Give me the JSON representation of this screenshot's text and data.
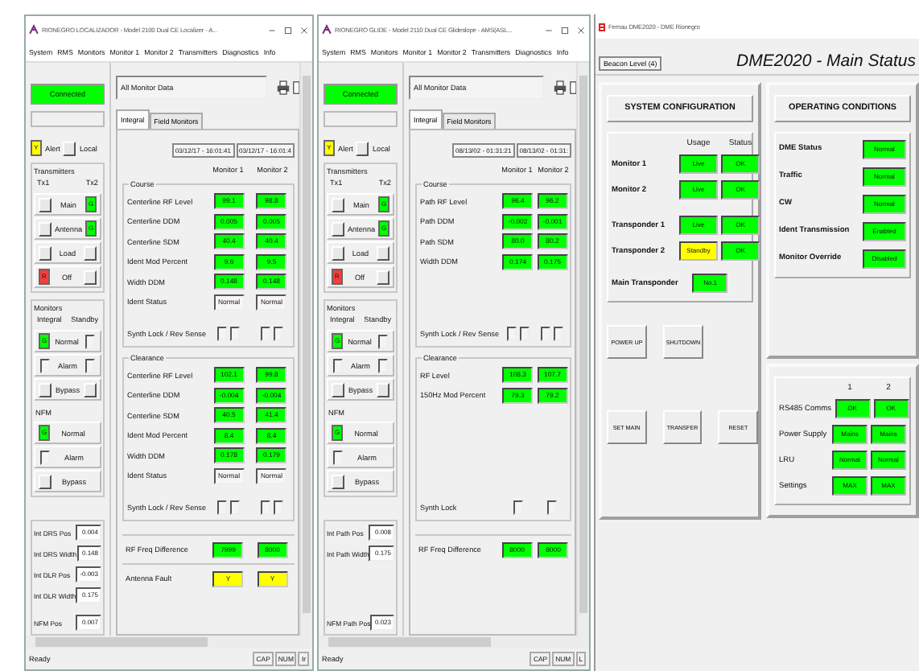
{
  "windows": [
    {
      "title": "RIONEGRO LOCALIZADOR - Model 2100 Dual CE Localizer - A...",
      "menu": [
        "System",
        "RMS",
        "Monitors",
        "Monitor 1",
        "Monitor 2",
        "Transmitters",
        "Diagnostics",
        "Info"
      ],
      "connection": "Connected",
      "alert": {
        "text": "Y",
        "color": "#ffff00",
        "label": "Alert",
        "local": "Local"
      },
      "transmitters": {
        "title": "Transmitters",
        "headers": [
          "Tx1",
          "Tx2"
        ],
        "rows": [
          {
            "label": "Main",
            "left": {
              "kind": "button"
            },
            "right": {
              "kind": "lamp",
              "text": "G",
              "color": "#00ff00"
            }
          },
          {
            "label": "Antenna",
            "left": {
              "kind": "button"
            },
            "right": {
              "kind": "lamp",
              "text": "G",
              "color": "#00ff00"
            }
          },
          {
            "label": "Load",
            "left": {
              "kind": "button"
            },
            "right": {
              "kind": "button"
            }
          },
          {
            "label": "Off",
            "left": {
              "kind": "lamp",
              "text": "R",
              "color": "#ff3b3b"
            },
            "right": {
              "kind": "button"
            }
          }
        ]
      },
      "monitors": {
        "title": "Monitors",
        "headers": [
          "Integral",
          "Standby"
        ],
        "rows": [
          {
            "label": "Normal",
            "left": {
              "kind": "lamp",
              "text": "G",
              "color": "#00ff00"
            },
            "right": {
              "kind": "box"
            }
          },
          {
            "label": "Alarm",
            "left": {
              "kind": "box"
            },
            "right": {
              "kind": "box"
            }
          },
          {
            "label": "Bypass",
            "left": {
              "kind": "button"
            },
            "right": {
              "kind": "button"
            }
          }
        ]
      },
      "nfm": {
        "title": "NFM",
        "rows": [
          {
            "label": "Normal",
            "left": {
              "kind": "lamp",
              "text": "G",
              "color": "#00ff00"
            }
          },
          {
            "label": "Alarm",
            "left": {
              "kind": "box"
            }
          },
          {
            "label": "Bypass",
            "left": {
              "kind": "button"
            }
          }
        ]
      },
      "readouts": [
        {
          "label": "Int DRS Pos",
          "value": "0.004"
        },
        {
          "label": "Int DRS Width",
          "value": "0.148"
        },
        {
          "label": "Int DLR Pos",
          "value": "-0.003"
        },
        {
          "label": "Int DLR Width",
          "value": "0.175"
        },
        {
          "label": "NFM Pos",
          "value": "0.007"
        }
      ],
      "data_title": "All Monitor Data",
      "tabs": [
        {
          "label": "Integral",
          "selected": true
        },
        {
          "label": "Field Monitors",
          "selected": false
        }
      ],
      "timestamps": [
        "03/12/17 - 16:01:41",
        "03/12/17 - 16:01:4"
      ],
      "columns": [
        "Monitor 1",
        "Monitor 2"
      ],
      "sections": [
        {
          "title": "Course",
          "rows": [
            {
              "label": "Centerline RF Level",
              "kind": "value",
              "values": [
                "99.1",
                "98.8"
              ],
              "color": "#00ff00"
            },
            {
              "label": "Centerline DDM",
              "kind": "value",
              "values": [
                "0.005",
                "0.005"
              ],
              "color": "#00ff00"
            },
            {
              "label": "Centerline SDM",
              "kind": "value",
              "values": [
                "40.4",
                "40.4"
              ],
              "color": "#00ff00"
            },
            {
              "label": "Ident Mod Percent",
              "kind": "value",
              "values": [
                "9.6",
                "9.5"
              ],
              "color": "#00ff00"
            },
            {
              "label": "Width DDM",
              "kind": "value",
              "values": [
                "0.148",
                "0.148"
              ],
              "color": "#00ff00"
            },
            {
              "label": "Ident Status",
              "kind": "status",
              "values": [
                "Normal",
                "Normal"
              ]
            },
            {
              "label": "Synth Lock / Rev Sense",
              "kind": "checks"
            }
          ]
        },
        {
          "title": "Clearance",
          "rows": [
            {
              "label": "Centerline RF Level",
              "kind": "value",
              "values": [
                "102.1",
                "99.8"
              ],
              "color": "#00ff00"
            },
            {
              "label": "Centerline DDM",
              "kind": "value",
              "values": [
                "-0.004",
                "-0.004"
              ],
              "color": "#00ff00"
            },
            {
              "label": "Centerline SDM",
              "kind": "value",
              "values": [
                "40.5",
                "41.4"
              ],
              "color": "#00ff00"
            },
            {
              "label": "Ident Mod Percent",
              "kind": "value",
              "values": [
                "8.4",
                "8.4"
              ],
              "color": "#00ff00"
            },
            {
              "label": "Width DDM",
              "kind": "value",
              "values": [
                "0.178",
                "0.179"
              ],
              "color": "#00ff00"
            },
            {
              "label": "Ident Status",
              "kind": "status",
              "values": [
                "Normal",
                "Normal"
              ]
            },
            {
              "label": "Synth Lock / Rev Sense",
              "kind": "checks"
            }
          ]
        }
      ],
      "footer_rows": [
        {
          "label": "RF Freq Difference",
          "kind": "value",
          "values": [
            "7999",
            "8000"
          ],
          "color": "#00ff00"
        },
        {
          "label": "Antenna Fault",
          "kind": "value",
          "values": [
            "Y",
            "Y"
          ],
          "color": "#ffff00"
        }
      ],
      "status": "Ready",
      "indicators": [
        "CAP",
        "NUM",
        "Ir"
      ]
    },
    {
      "title": "RIONEGRO GLIDE - Model 2110 Dual CE Glideslope - AMS(ASL...",
      "menu": [
        "System",
        "RMS",
        "Monitors",
        "Monitor 1",
        "Monitor 2",
        "Transmitters",
        "Diagnostics",
        "Info"
      ],
      "connection": "Connected",
      "alert": {
        "text": "Y",
        "color": "#ffff00",
        "label": "Alert",
        "local": "Local"
      },
      "transmitters": {
        "title": "Transmitters",
        "headers": [
          "Tx1",
          "Tx2"
        ],
        "rows": [
          {
            "label": "Main",
            "left": {
              "kind": "button"
            },
            "right": {
              "kind": "lamp",
              "text": "G",
              "color": "#00ff00"
            }
          },
          {
            "label": "Antenna",
            "left": {
              "kind": "button"
            },
            "right": {
              "kind": "lamp",
              "text": "G",
              "color": "#00ff00"
            }
          },
          {
            "label": "Load",
            "left": {
              "kind": "button"
            },
            "right": {
              "kind": "button"
            }
          },
          {
            "label": "Off",
            "left": {
              "kind": "lamp",
              "text": "R",
              "color": "#ff3b3b"
            },
            "right": {
              "kind": "button"
            }
          }
        ]
      },
      "monitors": {
        "title": "Monitors",
        "headers": [
          "Integral",
          "Standby"
        ],
        "rows": [
          {
            "label": "Normal",
            "left": {
              "kind": "lamp",
              "text": "G",
              "color": "#00ff00"
            },
            "right": {
              "kind": "box"
            }
          },
          {
            "label": "Alarm",
            "left": {
              "kind": "box"
            },
            "right": {
              "kind": "box"
            }
          },
          {
            "label": "Bypass",
            "left": {
              "kind": "button"
            },
            "right": {
              "kind": "button"
            }
          }
        ]
      },
      "nfm": {
        "title": "NFM",
        "rows": [
          {
            "label": "Normal",
            "left": {
              "kind": "lamp",
              "text": "G",
              "color": "#00ff00"
            }
          },
          {
            "label": "Alarm",
            "left": {
              "kind": "box"
            }
          },
          {
            "label": "Bypass",
            "left": {
              "kind": "button"
            }
          }
        ]
      },
      "readouts": [
        {
          "label": "Int Path Pos",
          "value": "0.008"
        },
        {
          "label": "Int Path Width",
          "value": "0.175"
        },
        {
          "label": "NFM Path Pos",
          "value": "0.023"
        }
      ],
      "data_title": "All Monitor Data",
      "tabs": [
        {
          "label": "Integral",
          "selected": true
        },
        {
          "label": "Field Monitors",
          "selected": false
        }
      ],
      "timestamps": [
        "08/13/02 - 01:31:21",
        "08/13/02 - 01:31:"
      ],
      "columns": [
        "Monitor 1",
        "Monitor 2"
      ],
      "sections": [
        {
          "title": "Course",
          "rows": [
            {
              "label": "Path RF Level",
              "kind": "value",
              "values": [
                "96.4",
                "96.2"
              ],
              "color": "#00ff00"
            },
            {
              "label": "Path DDM",
              "kind": "value",
              "values": [
                "-0.002",
                "-0.001"
              ],
              "color": "#00ff00"
            },
            {
              "label": "Path SDM",
              "kind": "value",
              "values": [
                "80.0",
                "80.2"
              ],
              "color": "#00ff00"
            },
            {
              "label": "Width DDM",
              "kind": "value",
              "values": [
                "0.174",
                "0.175"
              ],
              "color": "#00ff00"
            },
            {
              "label": "Synth Lock / Rev Sense",
              "kind": "checks"
            }
          ]
        },
        {
          "title": "Clearance",
          "rows": [
            {
              "label": "RF Level",
              "kind": "value",
              "values": [
                "108.3",
                "107.7"
              ],
              "color": "#00ff00"
            },
            {
              "label": "150Hz Mod Percent",
              "kind": "value",
              "values": [
                "79.3",
                "79.2"
              ],
              "color": "#00ff00"
            },
            {
              "label": "Synth Lock",
              "kind": "check"
            }
          ]
        }
      ],
      "footer_rows": [
        {
          "label": "RF Freq Difference",
          "kind": "value",
          "values": [
            "8000",
            "8000"
          ],
          "color": "#00ff00"
        }
      ],
      "status": "Ready",
      "indicators": [
        "CAP",
        "NUM",
        "L"
      ]
    }
  ],
  "dme": {
    "title": "Fernau DME2020 - DME Rionegro",
    "tab": "Beacon Level (4)",
    "heading": "DME2020 - Main Status",
    "config": {
      "title": "SYSTEM CONFIGURATION",
      "headers": [
        "Usage",
        "Status"
      ],
      "rows": [
        {
          "label": "Monitor 1",
          "cells": [
            {
              "text": "Live",
              "color": "#00ff00"
            },
            {
              "text": "OK",
              "color": "#00ff00"
            }
          ]
        },
        {
          "label": "Monitor 2",
          "cells": [
            {
              "text": "Live",
              "color": "#00ff00"
            },
            {
              "text": "OK",
              "color": "#00ff00"
            }
          ]
        },
        {
          "label": "Transponder 1",
          "cells": [
            {
              "text": "Live",
              "color": "#00ff00"
            },
            {
              "text": "OK",
              "color": "#00ff00"
            }
          ]
        },
        {
          "label": "Transponder 2",
          "cells": [
            {
              "text": "Standby",
              "color": "#ffff00"
            },
            {
              "text": "OK",
              "color": "#00ff00"
            }
          ]
        }
      ],
      "main": {
        "label": "Main Transponder",
        "text": "No.1",
        "color": "#00ff00"
      },
      "button_rows": [
        [
          "POWER UP",
          "SHUTDOWN"
        ],
        [
          "SET MAIN",
          "TRANSFER",
          "RESET"
        ]
      ]
    },
    "conditions": {
      "title": "OPERATING CONDITIONS",
      "rows": [
        {
          "label": "DME Status",
          "text": "Normal",
          "color": "#00ff00"
        },
        {
          "label": "Traffic",
          "text": "Normal",
          "color": "#00ff00"
        },
        {
          "label": "CW",
          "text": "Normal",
          "color": "#00ff00"
        },
        {
          "label": "Ident Transmission",
          "text": "Enabled",
          "color": "#00ff00"
        },
        {
          "label": "Monitor Override",
          "text": "Disabled",
          "color": "#00ff00"
        }
      ]
    },
    "units": {
      "headers": [
        "1",
        "2"
      ],
      "rows": [
        {
          "label": "RS485 Comms",
          "cells": [
            {
              "text": "OK",
              "color": "#00ff00"
            },
            {
              "text": "OK",
              "color": "#00ff00"
            }
          ]
        },
        {
          "label": "Power Supply",
          "cells": [
            {
              "text": "Mains",
              "color": "#00ff00"
            },
            {
              "text": "Mains",
              "color": "#00ff00"
            }
          ]
        },
        {
          "label": "LRU",
          "cells": [
            {
              "text": "Normal",
              "color": "#00ff00"
            },
            {
              "text": "Normal",
              "color": "#00ff00"
            }
          ]
        },
        {
          "label": "Settings",
          "cells": [
            {
              "text": "MAX",
              "color": "#00ff00"
            },
            {
              "text": "MAX",
              "color": "#00ff00"
            }
          ]
        }
      ]
    }
  }
}
